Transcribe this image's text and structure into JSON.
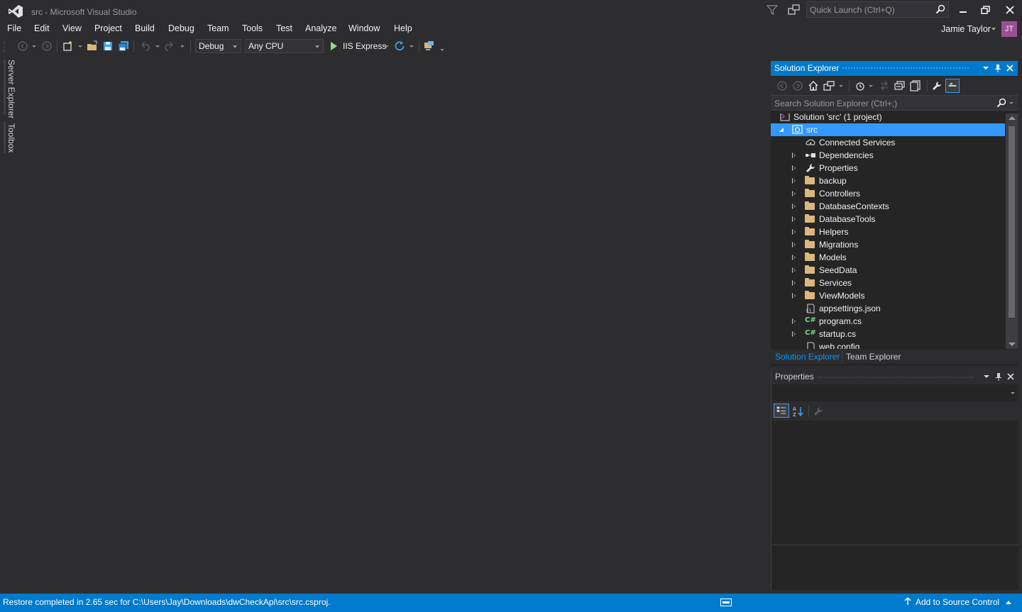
{
  "window": {
    "title": "src - Microsoft Visual Studio",
    "quick_launch_placeholder": "Quick Launch (Ctrl+Q)"
  },
  "menu": [
    "File",
    "Edit",
    "View",
    "Project",
    "Build",
    "Debug",
    "Team",
    "Tools",
    "Test",
    "Analyze",
    "Window",
    "Help"
  ],
  "account": {
    "name": "Jamie Taylor",
    "initials": "JT",
    "avatar_color": "#9b4f96"
  },
  "toolbar": {
    "configuration": "Debug",
    "platform": "Any CPU",
    "run_target": "IIS Express"
  },
  "side_tabs": [
    "Server Explorer",
    "Toolbox"
  ],
  "solution_explorer": {
    "title": "Solution Explorer",
    "search_placeholder": "Search Solution Explorer (Ctrl+;)",
    "tree": [
      {
        "label": "Solution 'src' (1 project)",
        "icon": "solution-icon",
        "expander": "none",
        "indent": 0
      },
      {
        "label": "src",
        "icon": "web-project-icon",
        "expander": "open",
        "indent": 1,
        "selected": true
      },
      {
        "label": "Connected Services",
        "icon": "connected-services-icon",
        "expander": "none",
        "indent": 2
      },
      {
        "label": "Dependencies",
        "icon": "dependencies-icon",
        "expander": "closed",
        "indent": 2
      },
      {
        "label": "Properties",
        "icon": "wrench-icon",
        "expander": "closed",
        "indent": 2
      },
      {
        "label": "backup",
        "icon": "folder-icon",
        "expander": "closed",
        "indent": 2
      },
      {
        "label": "Controllers",
        "icon": "folder-icon",
        "expander": "closed",
        "indent": 2
      },
      {
        "label": "DatabaseContexts",
        "icon": "folder-icon",
        "expander": "closed",
        "indent": 2
      },
      {
        "label": "DatabaseTools",
        "icon": "folder-icon",
        "expander": "closed",
        "indent": 2
      },
      {
        "label": "Helpers",
        "icon": "folder-icon",
        "expander": "closed",
        "indent": 2
      },
      {
        "label": "Migrations",
        "icon": "folder-icon",
        "expander": "closed",
        "indent": 2
      },
      {
        "label": "Models",
        "icon": "folder-icon",
        "expander": "closed",
        "indent": 2
      },
      {
        "label": "SeedData",
        "icon": "folder-icon",
        "expander": "closed",
        "indent": 2
      },
      {
        "label": "Services",
        "icon": "folder-icon",
        "expander": "closed",
        "indent": 2
      },
      {
        "label": "ViewModels",
        "icon": "folder-icon",
        "expander": "closed",
        "indent": 2
      },
      {
        "label": "appsettings.json",
        "icon": "json-file-icon",
        "expander": "none",
        "indent": 2
      },
      {
        "label": "program.cs",
        "icon": "csharp-file-icon",
        "expander": "closed",
        "indent": 2
      },
      {
        "label": "startup.cs",
        "icon": "csharp-file-icon",
        "expander": "closed",
        "indent": 2
      },
      {
        "label": "web.config",
        "icon": "config-file-icon",
        "expander": "none",
        "indent": 2
      }
    ],
    "tabs": [
      "Solution Explorer",
      "Team Explorer"
    ]
  },
  "properties": {
    "title": "Properties"
  },
  "status": {
    "message": "Restore completed in 2.65 sec for C:\\Users\\Jay\\Downloads\\dwCheckApi\\src\\src.csproj.",
    "source_control": "Add to Source Control"
  },
  "colors": {
    "accent": "#007acc",
    "selection": "#3399ff",
    "background": "#2d2d30",
    "panel": "#252526",
    "folder": "#dcb67a"
  }
}
